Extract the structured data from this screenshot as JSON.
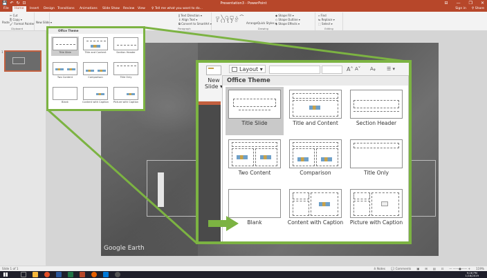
{
  "window": {
    "title": "Presentation3 - PowerPoint",
    "controls": [
      "⊟",
      "—",
      "❐",
      "✕"
    ]
  },
  "qat": {
    "save": "💾",
    "undo": "↶",
    "redo": "↻",
    "present": "⊡"
  },
  "tabs": {
    "items": [
      "File",
      "Home",
      "Insert",
      "Design",
      "Transitions",
      "Animations",
      "Slide Show",
      "Review",
      "View",
      "♀ Tell me what you want to do..."
    ],
    "active": "Home",
    "signin": "Sign in",
    "share": "⚲ Share"
  },
  "ribbon": {
    "clipboard": {
      "paste": "Paste",
      "cut": "✂ Cut",
      "copy": "⎘ Copy ▾",
      "format_painter": "🖌 Format Painter",
      "label": "Clipboard"
    },
    "slides": {
      "new": "New Slide ▾",
      "layout": "Layout ▾"
    },
    "paragraph": {
      "text_direction": "‖ Text Direction ▾",
      "align_text": "⇕ Align Text ▾",
      "convert": "⧉ Convert to SmartArt ▾",
      "label": "Paragraph"
    },
    "drawing": {
      "arrange": "Arrange",
      "quick_styles": "Quick Styles ▾",
      "shape_fill": "◆ Shape Fill ▾",
      "shape_outline": "◇ Shape Outline ▾",
      "shape_effects": "◈ Shape Effects ▾",
      "label": "Drawing"
    },
    "editing": {
      "find": "⌕ Find",
      "replace": "⇆ Replace ▾",
      "select": "⬚ Select ▾",
      "label": "Editing"
    }
  },
  "thumbpane": {
    "slide_number": "1"
  },
  "slide": {
    "attribution": "Google Earth"
  },
  "zoom_callout": {
    "new_slide_line1": "New",
    "new_slide_line2": "Slide ▾",
    "layout_button": "Layout ▾",
    "grow_font": "A˄",
    "shrink_font": "A˅",
    "clear_format": "Aᵩ",
    "list_icon": "☰ ▾",
    "gallery_header": "Office Theme",
    "layouts": [
      "Title Slide",
      "Title and Content",
      "Section Header",
      "Two Content",
      "Comparison",
      "Title Only",
      "Blank",
      "Content with Caption",
      "Picture with Caption"
    ],
    "selected_layout": "Title Slide",
    "arrow_color": "#7cb342"
  },
  "mini_popup": {
    "header": "Office Theme",
    "layouts": [
      "Title Slide",
      "Title and Content",
      "Section Header",
      "Two Content",
      "Comparison",
      "Title Only",
      "Blank",
      "Content with Caption",
      "Picture with Caption"
    ]
  },
  "statusbar": {
    "slide_info": "Slide 1 of 1",
    "notes": "≜ Notes",
    "comments": "💬 Comments",
    "zoom": "119%"
  },
  "taskbar": {
    "time": "9:26 PM",
    "date": "1/18/2019"
  },
  "colors": {
    "accent": "#b7472a",
    "highlight": "#7cb342",
    "taskbar": "#1f1f2b"
  }
}
